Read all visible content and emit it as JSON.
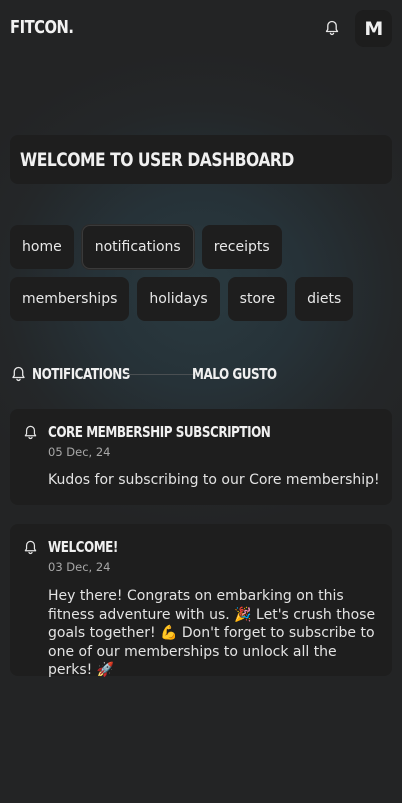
{
  "app": {
    "logo": "FITCON.",
    "avatar_initial": "M"
  },
  "welcome": {
    "title": "WELCOME TO USER DASHBOARD"
  },
  "nav": {
    "row1": [
      "home",
      "notifications",
      "receipts"
    ],
    "row2": [
      "memberships",
      "holidays",
      "store",
      "diets"
    ],
    "active": "notifications"
  },
  "section": {
    "title": "NOTIFICATIONS",
    "user": "MALO GUSTO"
  },
  "notifications": [
    {
      "title": "CORE MEMBERSHIP SUBSCRIPTION",
      "date": "05 Dec, 24",
      "body": "Kudos for subscribing to our Core membership!"
    },
    {
      "title": "WELCOME!",
      "date": "03 Dec, 24",
      "body": "Hey there! Congrats on embarking on this fitness adventure with us. 🎉 Let's crush those goals together! 💪 Don't forget to subscribe to one of our memberships to unlock all the perks! 🚀"
    }
  ],
  "icons": {
    "bell": "bell-icon"
  },
  "colors": {
    "background": "#232425",
    "card": "#1e1e1e",
    "text": "#f0f0f0",
    "muted": "#a8a8a8"
  }
}
